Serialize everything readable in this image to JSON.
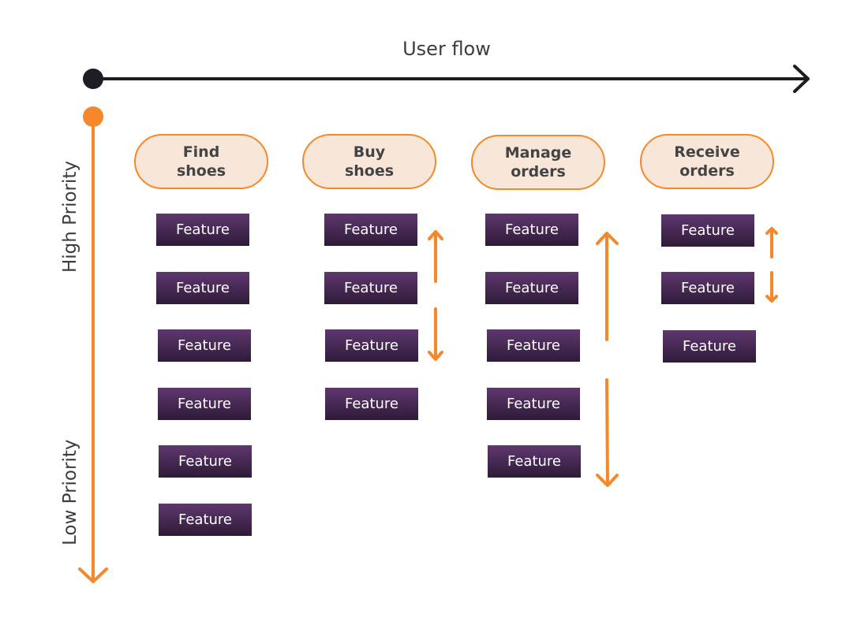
{
  "title": "User flow",
  "axis": {
    "high_label": "High Priority",
    "low_label": "Low Priority"
  },
  "colors": {
    "accent": "#f5882a",
    "flow_line": "#1c1e21",
    "pill_fill": "#f8e6d8",
    "feature_top": "#5f376f",
    "feature_bottom": "#2e1b38",
    "text": "#3d3d3d"
  },
  "columns": [
    {
      "line1": "Find",
      "line2": "shoes",
      "features": [
        "Feature",
        "Feature",
        "Feature",
        "Feature",
        "Feature",
        "Feature"
      ]
    },
    {
      "line1": "Buy",
      "line2": "shoes",
      "features": [
        "Feature",
        "Feature",
        "Feature",
        "Feature"
      ]
    },
    {
      "line1": "Manage",
      "line2": "orders",
      "features": [
        "Feature",
        "Feature",
        "Feature",
        "Feature",
        "Feature"
      ]
    },
    {
      "line1": "Receive",
      "line2": "orders",
      "features": [
        "Feature",
        "Feature",
        "Feature"
      ]
    }
  ],
  "icons": {
    "flow_arrow": "arrow-right-icon",
    "priority_arrow": "arrow-down-icon",
    "reorder_up": "arrow-up-icon",
    "reorder_down": "arrow-down-icon"
  }
}
